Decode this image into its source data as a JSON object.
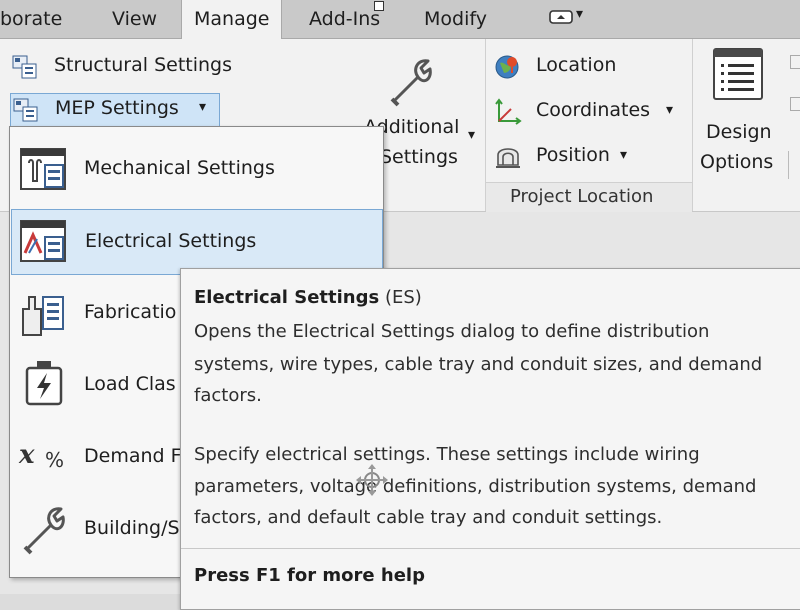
{
  "tabs": [
    {
      "label": "borate",
      "active": false
    },
    {
      "label": "View",
      "active": false
    },
    {
      "label": "Manage",
      "active": true
    },
    {
      "label": "Add-Ins",
      "active": false
    },
    {
      "label": "Modify",
      "active": false
    }
  ],
  "qat_dropdown_glyph": "▾",
  "ribbon": {
    "structural_settings": "Structural  Settings",
    "mep_settings": "MEP  Settings",
    "mep_chevron": "▾",
    "additional_settings_line1": "Additional",
    "additional_settings_line2": "Settings",
    "location": "Location",
    "coordinates": "Coordinates",
    "position": "Position",
    "dropdown_chevron": "▾",
    "project_location_panel": "Project Location",
    "design_options_line1": "Design",
    "design_options_line2": "Options"
  },
  "dropdown": {
    "items": [
      {
        "label": "Mechanical Settings",
        "icon": "mechanical-settings-icon",
        "highlighted": false
      },
      {
        "label": "Electrical Settings",
        "icon": "electrical-settings-icon",
        "highlighted": true
      },
      {
        "label": "Fabricatio",
        "icon": "fabrication-settings-icon",
        "highlighted": false
      },
      {
        "label": "Load Clas",
        "icon": "load-classifications-icon",
        "highlighted": false
      },
      {
        "label": "Demand F",
        "icon": "demand-factors-icon",
        "highlighted": false
      },
      {
        "label": "Building/S",
        "icon": "building-space-type-icon",
        "highlighted": false
      }
    ]
  },
  "tooltip": {
    "title": "Electrical Settings",
    "shortcut": "(ES)",
    "desc_lines": [
      "Opens the Electrical Settings dialog to define distribution",
      "systems, wire types, cable tray and conduit sizes, and demand",
      "factors."
    ],
    "detail_lines": [
      "Specify electrical settings. These settings include wiring",
      "parameters, voltage definitions, distribution systems, demand",
      "factors, and default cable tray and conduit settings."
    ],
    "help": "Press F1 for more help"
  },
  "colors": {
    "highlight_bg": "#d9e9f7",
    "highlight_border": "#7aa8d4",
    "ribbon_bg": "#f2f2f2",
    "tab_bar_bg": "#c9c9c9"
  }
}
